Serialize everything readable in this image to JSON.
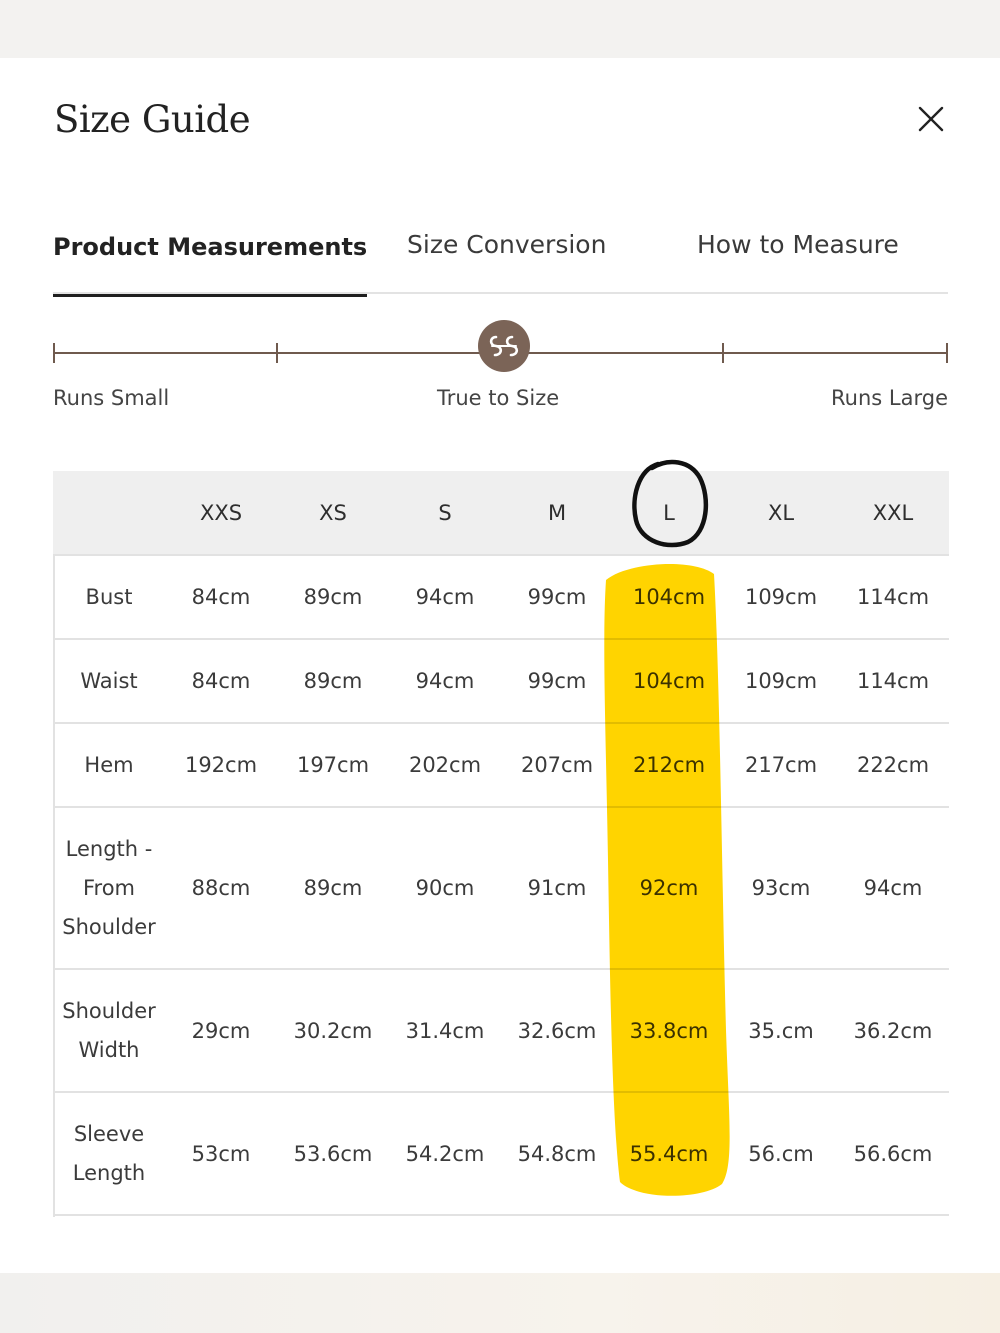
{
  "dialog": {
    "title": "Size Guide",
    "close_icon": "close-icon"
  },
  "tabs": [
    {
      "label": "Product Measurements",
      "active": true
    },
    {
      "label": "Size Conversion",
      "active": false
    },
    {
      "label": "How to Measure",
      "active": false
    }
  ],
  "fit_scale": {
    "left_label": "Runs Small",
    "center_label": "True to Size",
    "right_label": "Runs Large",
    "marker_icon": "brand-logo-icon",
    "marker_level": 0.5
  },
  "table": {
    "columns": [
      "",
      "XXS",
      "XS",
      "S",
      "M",
      "L",
      "XL",
      "XXL"
    ],
    "rows": [
      {
        "label": "Bust",
        "values": [
          "84cm",
          "89cm",
          "94cm",
          "99cm",
          "104cm",
          "109cm",
          "114cm"
        ]
      },
      {
        "label": "Waist",
        "values": [
          "84cm",
          "89cm",
          "94cm",
          "99cm",
          "104cm",
          "109cm",
          "114cm"
        ]
      },
      {
        "label": "Hem",
        "values": [
          "192cm",
          "197cm",
          "202cm",
          "207cm",
          "212cm",
          "217cm",
          "222cm"
        ]
      },
      {
        "label": "Length - From Shoulder",
        "values": [
          "88cm",
          "89cm",
          "90cm",
          "91cm",
          "92cm",
          "93cm",
          "94cm"
        ]
      },
      {
        "label": "Shoulder Width",
        "values": [
          "29cm",
          "30.2cm",
          "31.4cm",
          "32.6cm",
          "33.8cm",
          "35.cm",
          "36.2cm"
        ]
      },
      {
        "label": "Sleeve Length",
        "values": [
          "53cm",
          "53.6cm",
          "54.2cm",
          "54.8cm",
          "55.4cm",
          "56.cm",
          "56.6cm"
        ]
      }
    ]
  },
  "annotations": {
    "circled_column": "L",
    "highlight_color": "#ffd400",
    "circle_color": "#111111"
  },
  "colors": {
    "accent": "#7b6457",
    "header_bg": "#efefef",
    "divider": "#e2e2e2"
  }
}
